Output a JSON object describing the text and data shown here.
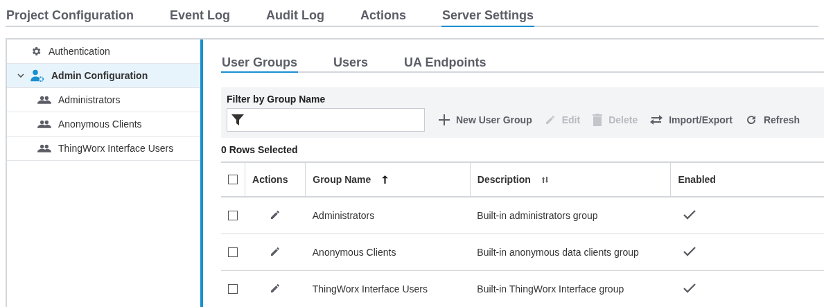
{
  "top_tabs": [
    {
      "label": "Project Configuration",
      "selected": false
    },
    {
      "label": "Event Log",
      "selected": false
    },
    {
      "label": "Audit Log",
      "selected": false
    },
    {
      "label": "Actions",
      "selected": false
    },
    {
      "label": "Server Settings",
      "selected": true
    }
  ],
  "sidebar": {
    "items": [
      {
        "label": "Authentication",
        "kind": "gear",
        "selected": false
      },
      {
        "label": "Admin Configuration",
        "kind": "admin",
        "selected": true,
        "expanded": true,
        "children": [
          {
            "label": "Administrators",
            "kind": "group",
            "selected": false
          },
          {
            "label": "Anonymous Clients",
            "kind": "group",
            "selected": false
          },
          {
            "label": "ThingWorx Interface Users",
            "kind": "group",
            "selected": false
          }
        ]
      }
    ]
  },
  "sub_tabs": [
    {
      "label": "User Groups",
      "selected": true
    },
    {
      "label": "Users",
      "selected": false
    },
    {
      "label": "UA Endpoints",
      "selected": false
    }
  ],
  "filter": {
    "label": "Filter by Group Name"
  },
  "toolbar": [
    {
      "label": "New User Group",
      "kind": "add",
      "disabled": false
    },
    {
      "label": "Edit",
      "kind": "edit",
      "disabled": true
    },
    {
      "label": "Delete",
      "kind": "delete",
      "disabled": true
    },
    {
      "label": "Import/Export",
      "kind": "swap",
      "disabled": false
    },
    {
      "label": "Refresh",
      "kind": "refresh",
      "disabled": false
    }
  ],
  "selection_count": "0 Rows Selected",
  "table": {
    "header_checked": false,
    "columns": [
      {
        "label": "Actions"
      },
      {
        "label": "Group Name",
        "sortable": true,
        "sorted": true
      },
      {
        "label": "Description",
        "sortable": true,
        "sorted": false
      },
      {
        "label": "Enabled"
      }
    ],
    "rows": [
      {
        "checked": false,
        "name": "Administrators",
        "description": "Built-in administrators group",
        "enabled": true
      },
      {
        "checked": false,
        "name": "Anonymous Clients",
        "description": "Built-in anonymous data clients group",
        "enabled": true
      },
      {
        "checked": false,
        "name": "ThingWorx Interface Users",
        "description": "Built-in ThingWorx Interface group",
        "enabled": true
      }
    ]
  }
}
